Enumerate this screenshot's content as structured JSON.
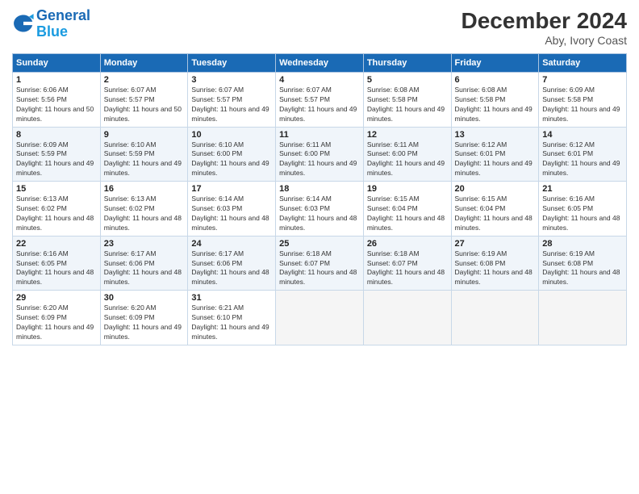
{
  "header": {
    "logo_general": "General",
    "logo_blue": "Blue",
    "month_title": "December 2024",
    "location": "Aby, Ivory Coast"
  },
  "weekdays": [
    "Sunday",
    "Monday",
    "Tuesday",
    "Wednesday",
    "Thursday",
    "Friday",
    "Saturday"
  ],
  "weeks": [
    [
      {
        "day": "1",
        "sunrise": "6:06 AM",
        "sunset": "5:56 PM",
        "daylight": "11 hours and 50 minutes."
      },
      {
        "day": "2",
        "sunrise": "6:07 AM",
        "sunset": "5:57 PM",
        "daylight": "11 hours and 50 minutes."
      },
      {
        "day": "3",
        "sunrise": "6:07 AM",
        "sunset": "5:57 PM",
        "daylight": "11 hours and 49 minutes."
      },
      {
        "day": "4",
        "sunrise": "6:07 AM",
        "sunset": "5:57 PM",
        "daylight": "11 hours and 49 minutes."
      },
      {
        "day": "5",
        "sunrise": "6:08 AM",
        "sunset": "5:58 PM",
        "daylight": "11 hours and 49 minutes."
      },
      {
        "day": "6",
        "sunrise": "6:08 AM",
        "sunset": "5:58 PM",
        "daylight": "11 hours and 49 minutes."
      },
      {
        "day": "7",
        "sunrise": "6:09 AM",
        "sunset": "5:58 PM",
        "daylight": "11 hours and 49 minutes."
      }
    ],
    [
      {
        "day": "8",
        "sunrise": "6:09 AM",
        "sunset": "5:59 PM",
        "daylight": "11 hours and 49 minutes."
      },
      {
        "day": "9",
        "sunrise": "6:10 AM",
        "sunset": "5:59 PM",
        "daylight": "11 hours and 49 minutes."
      },
      {
        "day": "10",
        "sunrise": "6:10 AM",
        "sunset": "6:00 PM",
        "daylight": "11 hours and 49 minutes."
      },
      {
        "day": "11",
        "sunrise": "6:11 AM",
        "sunset": "6:00 PM",
        "daylight": "11 hours and 49 minutes."
      },
      {
        "day": "12",
        "sunrise": "6:11 AM",
        "sunset": "6:00 PM",
        "daylight": "11 hours and 49 minutes."
      },
      {
        "day": "13",
        "sunrise": "6:12 AM",
        "sunset": "6:01 PM",
        "daylight": "11 hours and 49 minutes."
      },
      {
        "day": "14",
        "sunrise": "6:12 AM",
        "sunset": "6:01 PM",
        "daylight": "11 hours and 49 minutes."
      }
    ],
    [
      {
        "day": "15",
        "sunrise": "6:13 AM",
        "sunset": "6:02 PM",
        "daylight": "11 hours and 48 minutes."
      },
      {
        "day": "16",
        "sunrise": "6:13 AM",
        "sunset": "6:02 PM",
        "daylight": "11 hours and 48 minutes."
      },
      {
        "day": "17",
        "sunrise": "6:14 AM",
        "sunset": "6:03 PM",
        "daylight": "11 hours and 48 minutes."
      },
      {
        "day": "18",
        "sunrise": "6:14 AM",
        "sunset": "6:03 PM",
        "daylight": "11 hours and 48 minutes."
      },
      {
        "day": "19",
        "sunrise": "6:15 AM",
        "sunset": "6:04 PM",
        "daylight": "11 hours and 48 minutes."
      },
      {
        "day": "20",
        "sunrise": "6:15 AM",
        "sunset": "6:04 PM",
        "daylight": "11 hours and 48 minutes."
      },
      {
        "day": "21",
        "sunrise": "6:16 AM",
        "sunset": "6:05 PM",
        "daylight": "11 hours and 48 minutes."
      }
    ],
    [
      {
        "day": "22",
        "sunrise": "6:16 AM",
        "sunset": "6:05 PM",
        "daylight": "11 hours and 48 minutes."
      },
      {
        "day": "23",
        "sunrise": "6:17 AM",
        "sunset": "6:06 PM",
        "daylight": "11 hours and 48 minutes."
      },
      {
        "day": "24",
        "sunrise": "6:17 AM",
        "sunset": "6:06 PM",
        "daylight": "11 hours and 48 minutes."
      },
      {
        "day": "25",
        "sunrise": "6:18 AM",
        "sunset": "6:07 PM",
        "daylight": "11 hours and 48 minutes."
      },
      {
        "day": "26",
        "sunrise": "6:18 AM",
        "sunset": "6:07 PM",
        "daylight": "11 hours and 48 minutes."
      },
      {
        "day": "27",
        "sunrise": "6:19 AM",
        "sunset": "6:08 PM",
        "daylight": "11 hours and 48 minutes."
      },
      {
        "day": "28",
        "sunrise": "6:19 AM",
        "sunset": "6:08 PM",
        "daylight": "11 hours and 48 minutes."
      }
    ],
    [
      {
        "day": "29",
        "sunrise": "6:20 AM",
        "sunset": "6:09 PM",
        "daylight": "11 hours and 49 minutes."
      },
      {
        "day": "30",
        "sunrise": "6:20 AM",
        "sunset": "6:09 PM",
        "daylight": "11 hours and 49 minutes."
      },
      {
        "day": "31",
        "sunrise": "6:21 AM",
        "sunset": "6:10 PM",
        "daylight": "11 hours and 49 minutes."
      },
      null,
      null,
      null,
      null
    ]
  ]
}
